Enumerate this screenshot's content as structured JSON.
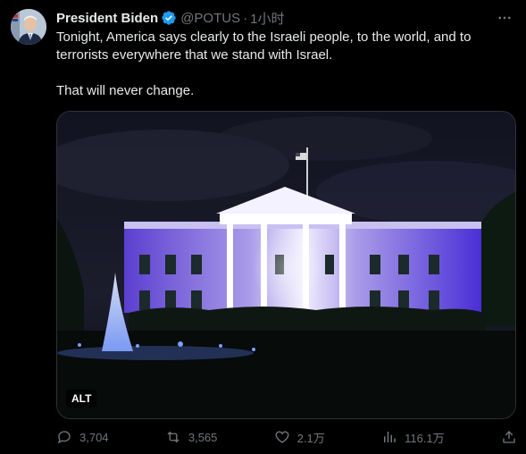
{
  "tweet": {
    "display_name": "President Biden",
    "handle": "@POTUS",
    "separator": "·",
    "time": "1小时",
    "text_line1": "Tonight, America says clearly to the Israeli people, to the world, and to terrorists everywhere that we stand with Israel.",
    "text_line2": "That will never change.",
    "media_alt_badge": "ALT",
    "icons": {
      "verified": "verified-badge-icon",
      "more": "more-options-icon",
      "reply": "reply-icon",
      "retweet": "retweet-icon",
      "like": "like-icon",
      "views": "views-icon",
      "share": "share-icon"
    },
    "colors": {
      "background": "#000000",
      "text": "#e7e9ea",
      "muted": "#71767b",
      "verified": "#1d9bf0"
    }
  },
  "actions": {
    "replies": "3,704",
    "retweets": "3,565",
    "likes": "2.1万",
    "views": "116.1万"
  }
}
